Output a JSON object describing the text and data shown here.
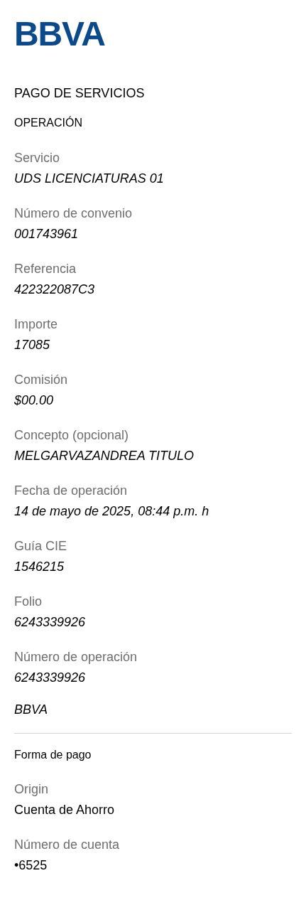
{
  "logo": "BBVA",
  "title": "PAGO DE SERVICIOS",
  "operation": {
    "heading": "OPERACIÓN",
    "fields": [
      {
        "label": "Servicio",
        "value": "UDS LICENCIATURAS 01"
      },
      {
        "label": "Número de convenio",
        "value": "001743961"
      },
      {
        "label": "Referencia",
        "value": "422322087C3"
      },
      {
        "label": "Importe",
        "value": "17085"
      },
      {
        "label": "Comisión",
        "value": "$00.00"
      },
      {
        "label": "Concepto (opcional)",
        "value": "MELGARVAZANDREA TITULO"
      },
      {
        "label": "Fecha de operación",
        "value": "14 de mayo de 2025, 08:44 p.m. h"
      },
      {
        "label": "Guía CIE",
        "value": "1546215"
      },
      {
        "label": "Folio",
        "value": "6243339926"
      },
      {
        "label": "Número de operación",
        "value": "6243339926"
      }
    ],
    "bank": "BBVA"
  },
  "payment": {
    "heading": "Forma de pago",
    "fields": [
      {
        "label": "Origin",
        "value": "Cuenta de Ahorro"
      },
      {
        "label": "Número de cuenta",
        "value": "•6525"
      }
    ]
  }
}
